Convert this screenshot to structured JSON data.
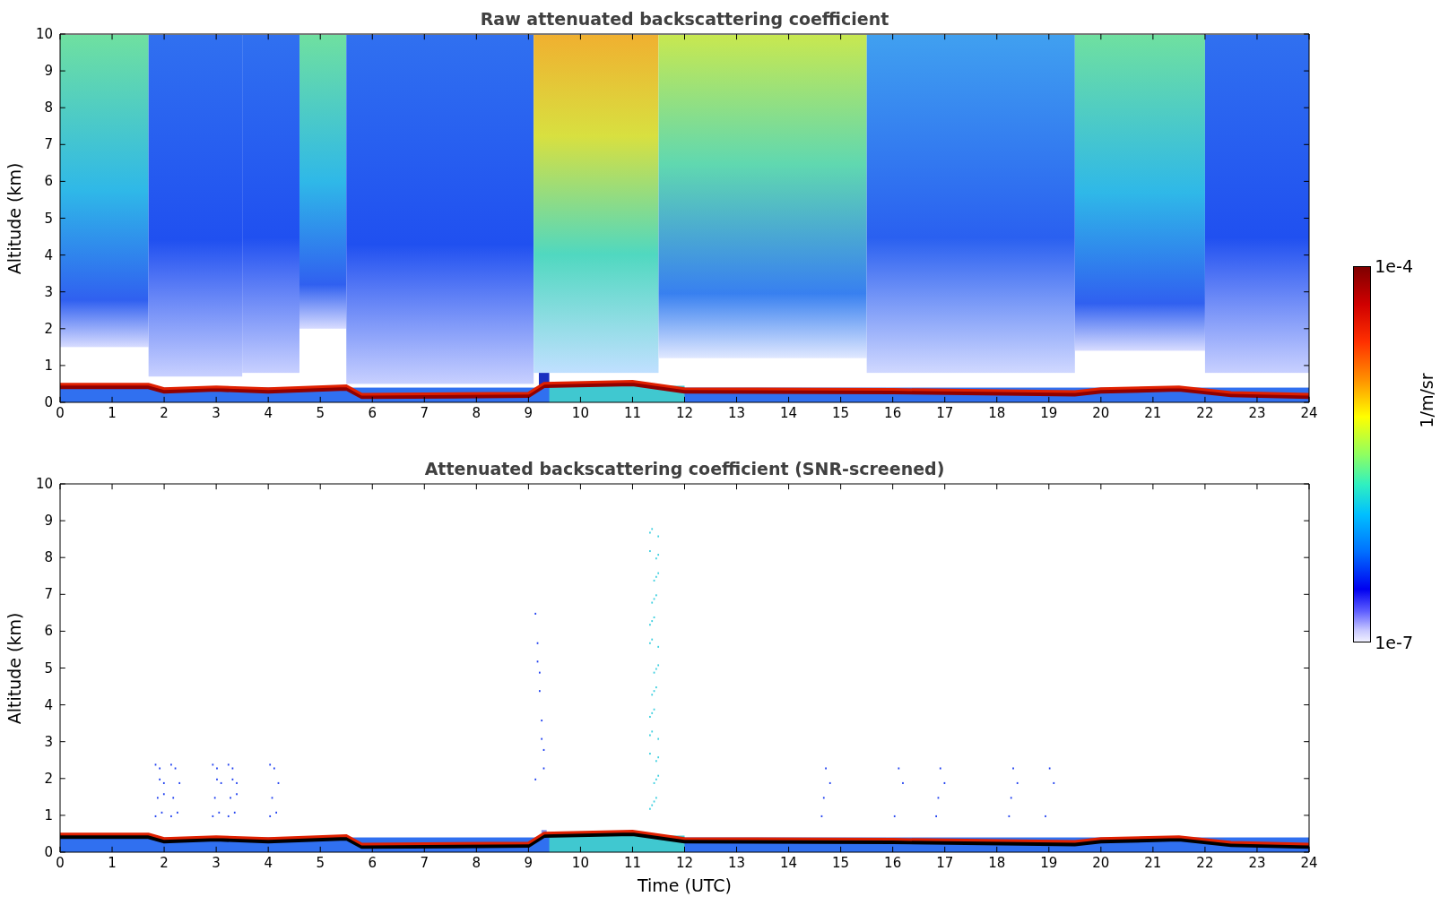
{
  "panels": [
    {
      "kind": "raw",
      "title": "Raw attenuated backscattering coefficient",
      "ylabel": "Altitude (km)",
      "yticks": [
        "10",
        "9",
        "8",
        "7",
        "6",
        "5",
        "4",
        "3",
        "2",
        "1",
        "0"
      ],
      "xticks": [
        "0",
        "1",
        "2",
        "3",
        "4",
        "5",
        "6",
        "7",
        "8",
        "9",
        "10",
        "11",
        "12",
        "13",
        "14",
        "15",
        "16",
        "17",
        "18",
        "19",
        "20",
        "21",
        "22",
        "23",
        "24"
      ]
    },
    {
      "kind": "screened",
      "title": "Attenuated backscattering coefficient (SNR-screened)",
      "ylabel": "Altitude (km)",
      "yticks": [
        "10",
        "9",
        "8",
        "7",
        "6",
        "5",
        "4",
        "3",
        "2",
        "1",
        "0"
      ],
      "xticks": [
        "0",
        "1",
        "2",
        "3",
        "4",
        "5",
        "6",
        "7",
        "8",
        "9",
        "10",
        "11",
        "12",
        "13",
        "14",
        "15",
        "16",
        "17",
        "18",
        "19",
        "20",
        "21",
        "22",
        "23",
        "24"
      ]
    }
  ],
  "xlabel": "Time (UTC)",
  "colorbar": {
    "max_label": "1e-4",
    "min_label": "1e-7",
    "unit": "1/m/sr"
  }
}
